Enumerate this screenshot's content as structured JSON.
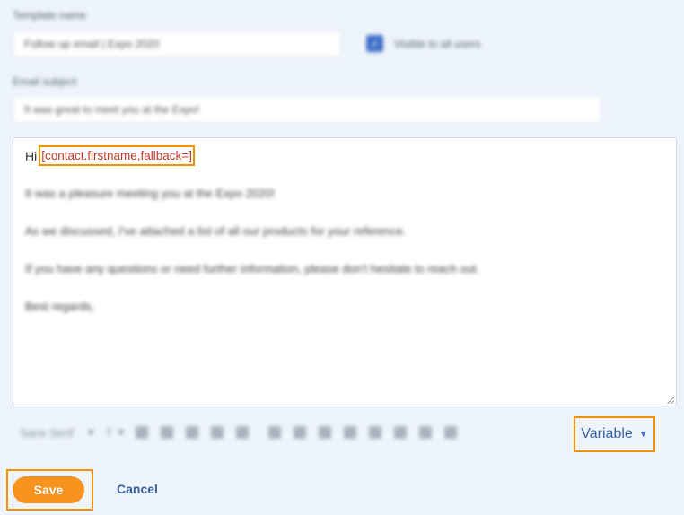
{
  "template": {
    "name_label": "Template name",
    "name_value": "Follow up email | Expo 2020",
    "visible_label": "Visible to all users",
    "subject_label": "Email subject",
    "subject_value": "It was great to meet you at the Expo!"
  },
  "editor": {
    "greeting": "Hi",
    "variable": "[contact.firstname,fallback=]",
    "lines": [
      "It was a pleasure meeting you at the Expo 2020!",
      "As we discussed, I've attached a list of all our products for your reference.",
      "If you have any questions or need further information, please don't hesitate to reach out.",
      "Best regards,"
    ]
  },
  "toolbar": {
    "font_family": "Sans Serif",
    "font_size": "T"
  },
  "actions": {
    "variable_label": "Variable",
    "save_label": "Save",
    "cancel_label": "Cancel"
  },
  "colors": {
    "accent": "#f7931e",
    "highlight_border": "#f39200",
    "link": "#3a5f9e",
    "variable_text": "#c0392b",
    "checkbox": "#3e6fc7"
  },
  "icons": [
    "chevron-down-icon",
    "bold-icon",
    "italic-icon",
    "underline-icon",
    "strikethrough-icon",
    "text-color-icon",
    "ordered-list-icon",
    "bullet-list-icon",
    "link-icon",
    "image-icon",
    "video-icon",
    "attachment-icon",
    "clean-icon",
    "code-icon"
  ]
}
